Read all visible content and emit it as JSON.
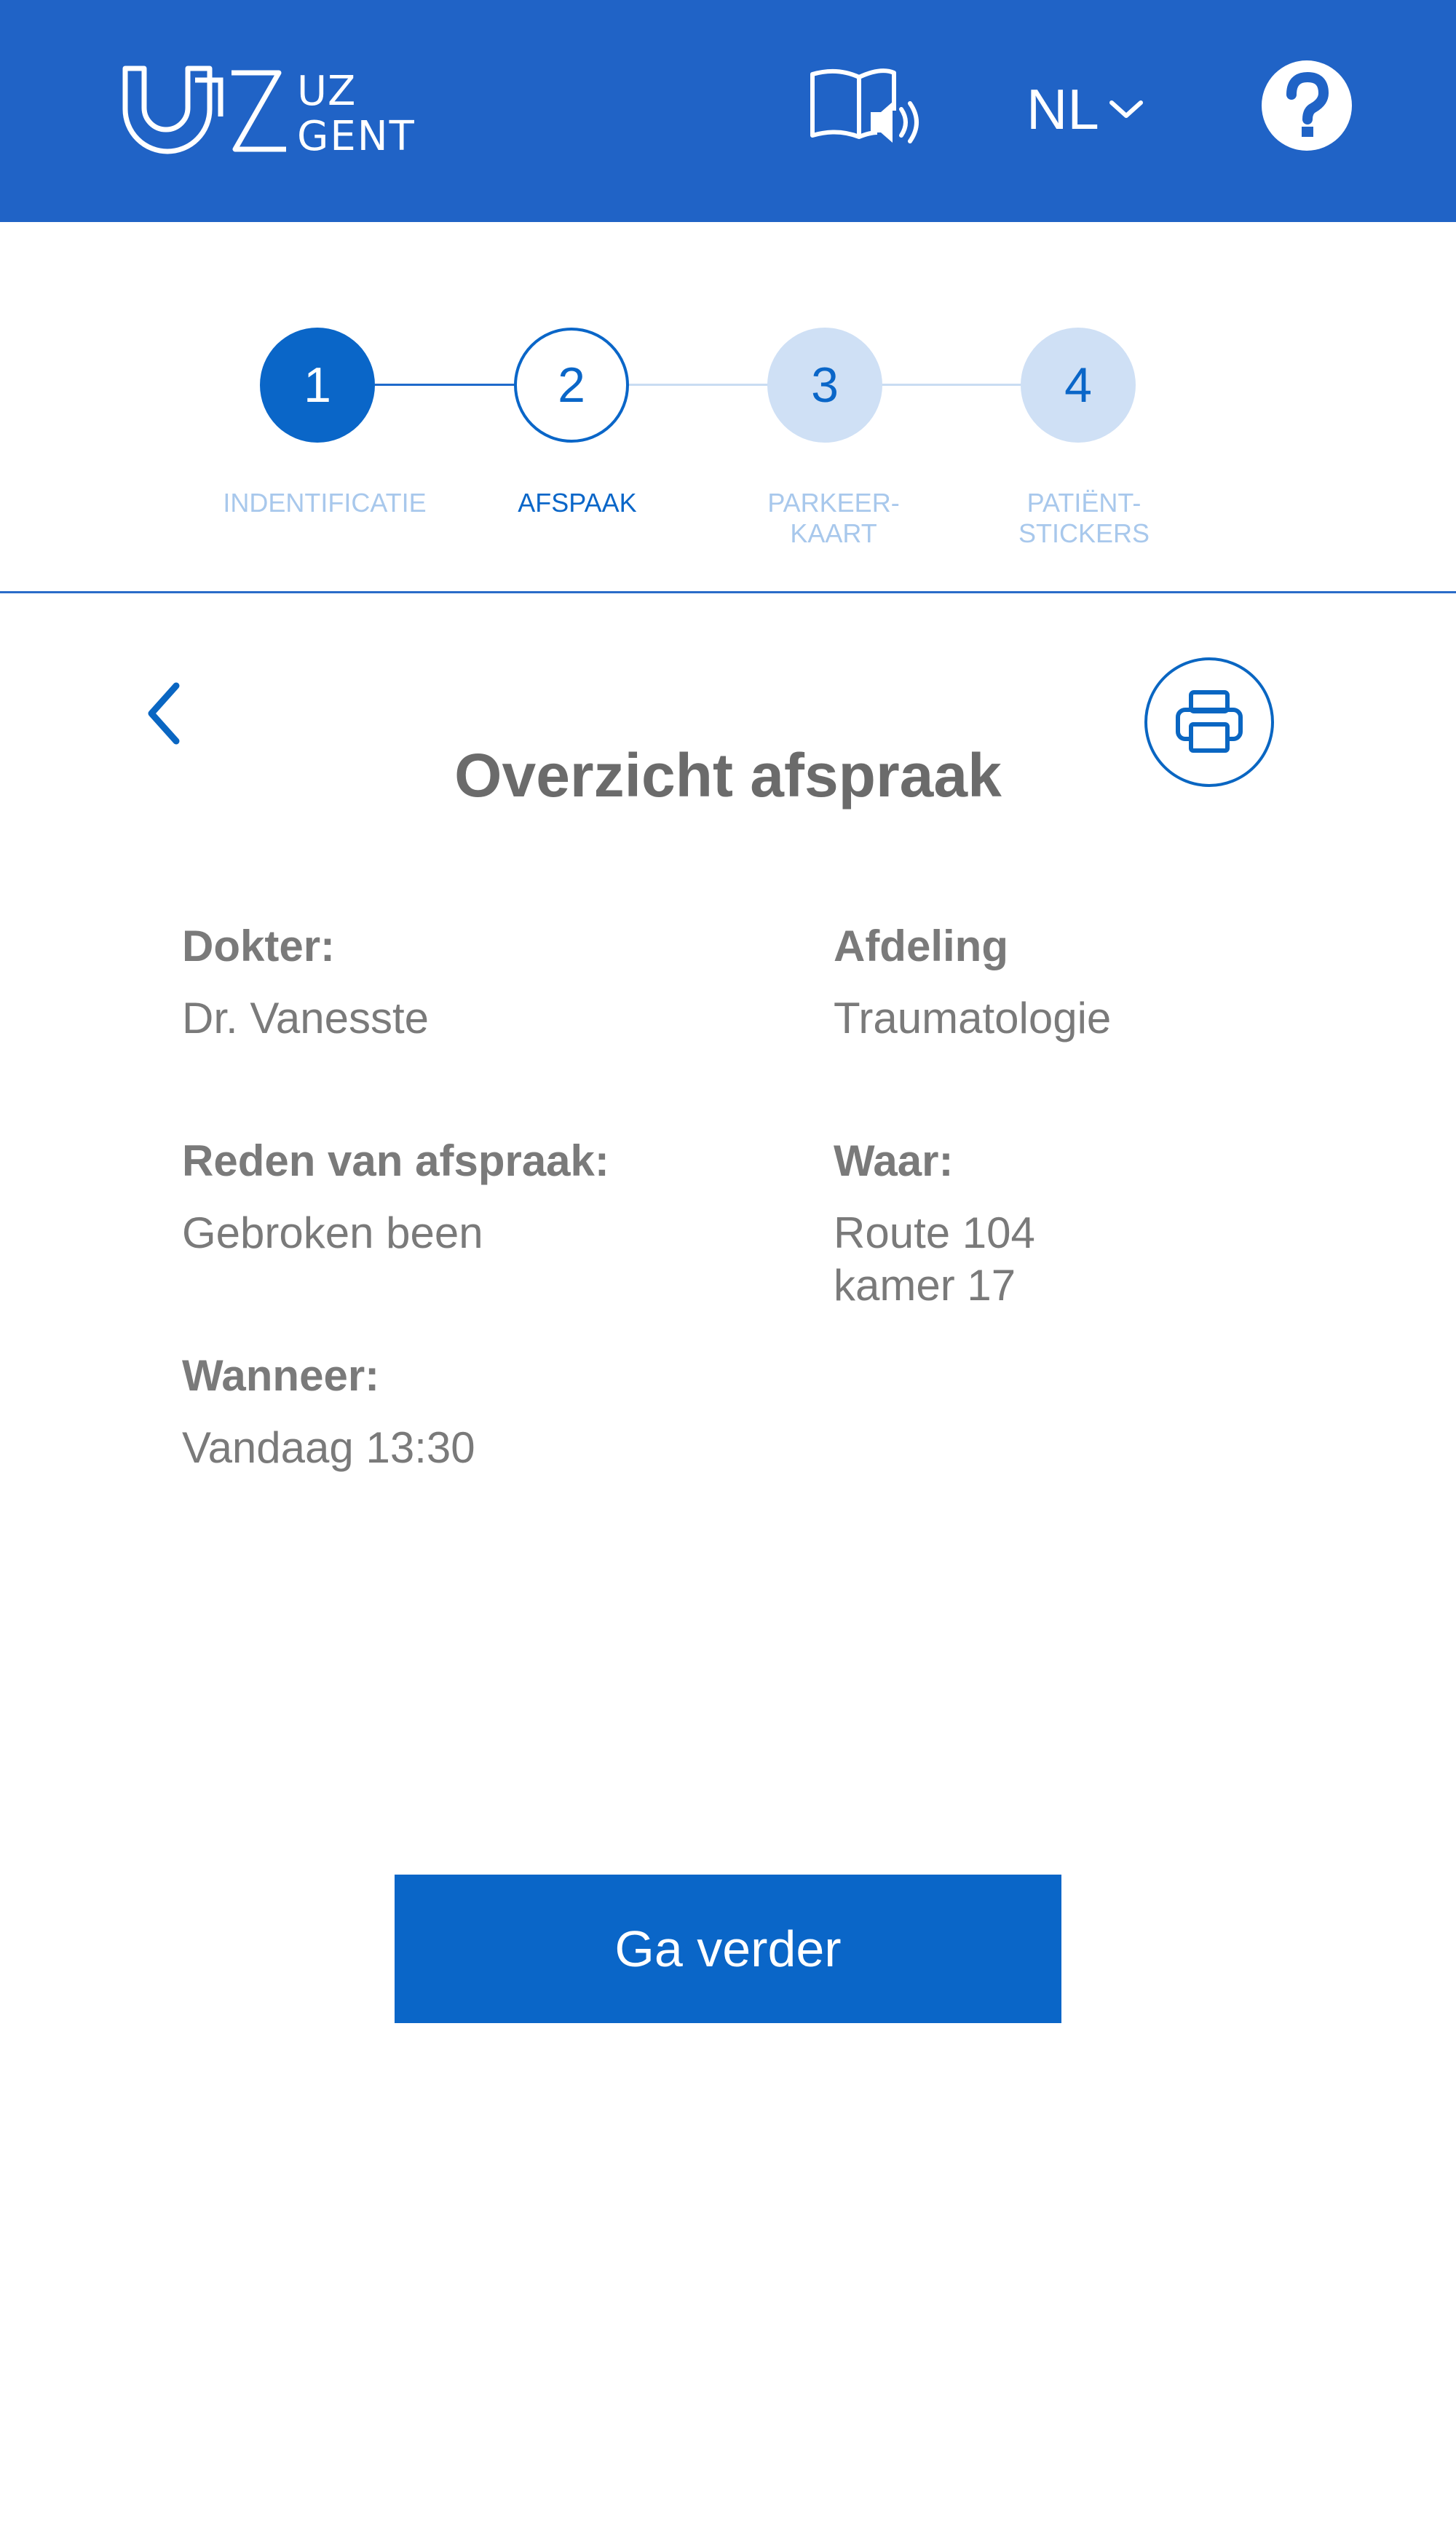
{
  "header": {
    "logo_line1": "UZ",
    "logo_line2": "GENT",
    "language": "NL",
    "icons": {
      "audio": "book-audio-icon",
      "language_dropdown": "chevron-down-icon",
      "help": "question-mark-icon"
    },
    "background_color": "#2063c6"
  },
  "stepper": {
    "steps": [
      {
        "number": "1",
        "label": "INDENTIFICATIE",
        "state": "completed"
      },
      {
        "number": "2",
        "label": "AFSPAAK",
        "state": "current"
      },
      {
        "number": "3",
        "label_line1": "PARKEER-",
        "label_line2": "KAART",
        "state": "upcoming"
      },
      {
        "number": "4",
        "label_line1": "PATIËNT-",
        "label_line2": "STICKERS",
        "state": "upcoming"
      }
    ],
    "colors": {
      "active": "#0a66c8",
      "inactive_fill": "#cfe0f5",
      "inactive_text": "#a8c8ec"
    }
  },
  "main": {
    "title": "Overzicht afspraak",
    "icons": {
      "back": "chevron-left-icon",
      "print": "printer-icon"
    },
    "fields": {
      "doctor": {
        "label": "Dokter:",
        "value": "Dr. Vanesste"
      },
      "department": {
        "label": "Afdeling",
        "value": "Traumatologie"
      },
      "reason": {
        "label": "Reden van afspraak:",
        "value": "Gebroken been"
      },
      "where": {
        "label": "Waar:",
        "value_line1": "Route 104",
        "value_line2": "kamer 17"
      },
      "when": {
        "label": "Wanneer:",
        "value": "Vandaag 13:30"
      }
    },
    "continue_button": "Ga verder"
  }
}
